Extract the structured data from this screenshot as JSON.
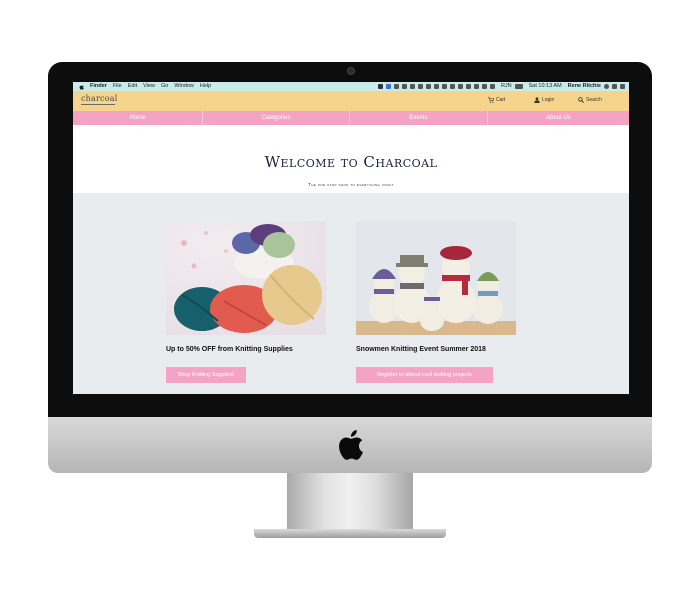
{
  "menubar": {
    "items": [
      "Finder",
      "File",
      "Edit",
      "View",
      "Go",
      "Window",
      "Help"
    ],
    "right": {
      "lang": "RJN",
      "clock": "Sat 10:13 AM",
      "user": "Rene Ritchie"
    }
  },
  "site": {
    "logo": "charcoal",
    "header": {
      "cart": "Cart",
      "login": "Login",
      "search": "Search"
    },
    "nav": [
      "Home",
      "Categories",
      "Events",
      "About Us"
    ],
    "hero": {
      "title": "Welcome to Charcoal",
      "subtitle": "The one stop shop to everything craft"
    },
    "cards": [
      {
        "title": "Up to 50% OFF from Knitting Supplies",
        "button": "Shop Knitting Supplies!"
      },
      {
        "title": "Snowmen Knitting Event Summer 2018",
        "button": "Register to attend cool knitting projects"
      }
    ]
  },
  "colors": {
    "menubar": "#c9ece9",
    "header": "#f6d48c",
    "nav": "#f4a3c4",
    "content_bg": "#e9ecee",
    "hero_title": "#1e2040"
  }
}
